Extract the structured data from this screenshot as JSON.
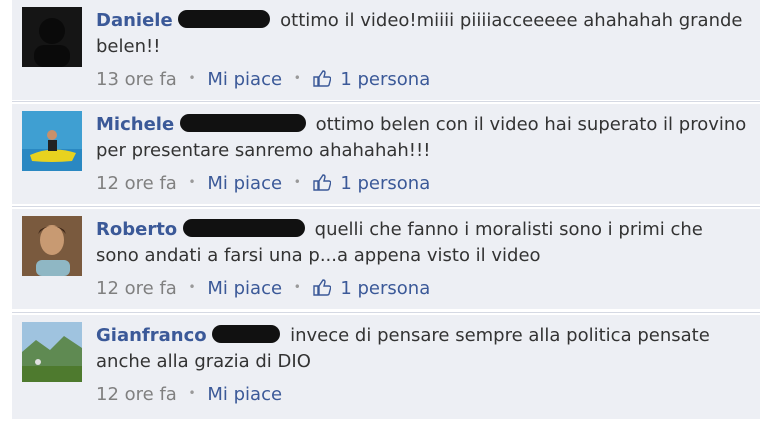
{
  "comments": [
    {
      "author": "Daniele",
      "text": "ottimo il video!miiii piiiiacceeeee ahahahah grande belen!!",
      "time": "13 ore fa",
      "like_label": "Mi piace",
      "likes": "1 persona"
    },
    {
      "author": "Michele",
      "text": "ottimo belen con il video hai superato il provino per presentare sanremo ahahahah!!!",
      "time": "12 ore fa",
      "like_label": "Mi piace",
      "likes": "1 persona"
    },
    {
      "author": "Roberto",
      "text": "quelli che fanno i moralisti sono i primi che sono andati a farsi una p...a appena visto il video",
      "time": "12 ore fa",
      "like_label": "Mi piace",
      "likes": "1 persona"
    },
    {
      "author": "Gianfranco",
      "text": "invece di pensare sempre alla politica pensate anche alla grazia di DIO",
      "time": "12 ore fa",
      "like_label": "Mi piace",
      "likes": null
    }
  ],
  "icons": {
    "like": "thumbs-up-icon",
    "separator": "middle-dot"
  },
  "colors": {
    "background": "#edeff4",
    "author_link": "#3b5998",
    "meta_text": "#808080"
  }
}
